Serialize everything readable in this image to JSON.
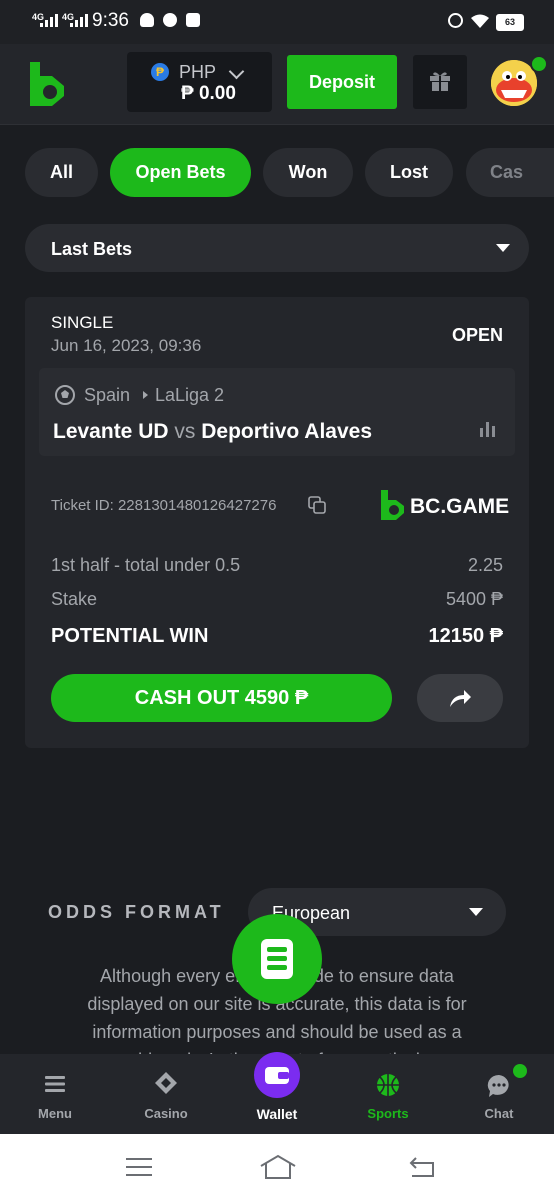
{
  "status_bar": {
    "time": "9:36",
    "network1": "4G",
    "network2": "4G",
    "battery": "63"
  },
  "header": {
    "currency_code": "PHP",
    "currency_symbol": "₱",
    "balance": "₱ 0.00",
    "deposit_label": "Deposit"
  },
  "tabs": [
    {
      "label": "All",
      "active": false
    },
    {
      "label": "Open Bets",
      "active": true
    },
    {
      "label": "Won",
      "active": false
    },
    {
      "label": "Lost",
      "active": false
    },
    {
      "label": "Cas",
      "active": false
    }
  ],
  "filter": {
    "label": "Last Bets"
  },
  "bet": {
    "type": "SINGLE",
    "datetime": "Jun 16, 2023, 09:36",
    "status": "OPEN",
    "country": "Spain",
    "league": "LaLiga 2",
    "home": "Levante UD",
    "vs": "vs",
    "away": "Deportivo Alaves",
    "ticket_id": "Ticket ID: 2281301480126427276",
    "brand": "BC.GAME",
    "market": "1st half - total under 0.5",
    "odds": "2.25",
    "stake_label": "Stake",
    "stake_value": "5400 ₱",
    "potential_label": "POTENTIAL WIN",
    "potential_value": "12150 ₱",
    "cashout_label": "CASH OUT 4590 ₱"
  },
  "odds_format": {
    "title": "ODDS FORMAT",
    "value": "European"
  },
  "disclaimer": {
    "line1": "Although every effort is made to ensure data",
    "line2": "displayed on our site is accurate, this data is for",
    "line3": "information purposes and should be used as a",
    "line4": "guide only. In the event of any particular"
  },
  "bottom_nav": [
    {
      "label": "Menu",
      "icon": "menu-icon"
    },
    {
      "label": "Casino",
      "icon": "casino-icon"
    },
    {
      "label": "Wallet",
      "icon": "wallet-icon"
    },
    {
      "label": "Sports",
      "icon": "basketball-icon"
    },
    {
      "label": "Chat",
      "icon": "chat-icon"
    }
  ],
  "colors": {
    "accent": "#1db91b",
    "bg": "#1b1d21",
    "card": "#24262b",
    "wallet": "#7b2cf0"
  }
}
